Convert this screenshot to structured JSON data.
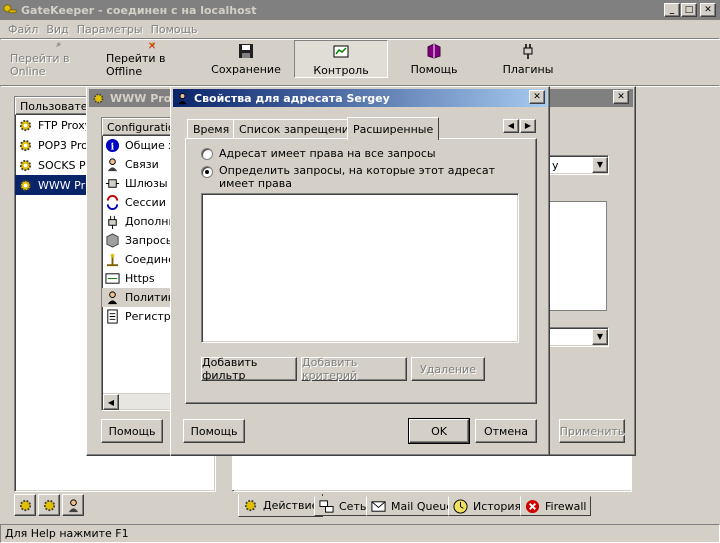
{
  "window": {
    "title": "GateKeeper - соединен с на localhost"
  },
  "menu": [
    "Файл",
    "Вид",
    "Параметры",
    "Помощь"
  ],
  "toolbar": {
    "go_online": "Перейти в Online",
    "go_offline": "Перейти в Offline",
    "save": "Сохранение",
    "control": "Контроль",
    "help": "Помощь",
    "plugins": "Плагины"
  },
  "left_panel": {
    "header": "Пользовате",
    "items": [
      "FTP Proxy",
      "POP3 Pro",
      "SOCKS P",
      "WWW Pr"
    ]
  },
  "proxy_window": {
    "title": "WWW Prox",
    "tree_header": "Configuration",
    "tree_items": [
      "Общие х",
      "Связи",
      "Шлюзы",
      "Сессии",
      "Дополни",
      "Запросы",
      "Соедине",
      "Https",
      "Политик",
      "Регистра"
    ],
    "help_button": "Помощь",
    "combo_value": "y",
    "apply_button": "Применить"
  },
  "dialog": {
    "title": "Свойства для адресата Sergey",
    "tabs": [
      "Время",
      "Список запрещений",
      "Расширенные"
    ],
    "radio_all": "Адресат имеет права на все запросы",
    "radio_define": "Определить запросы, на которые этот адресат имеет права",
    "add_filter": "Добавить фильтр",
    "add_criteria": "Добавить критерий",
    "delete": "Удаление",
    "help": "Помощь",
    "ok": "OK",
    "cancel": "Отмена"
  },
  "bottom_tabs": [
    "Действие",
    "Сеть",
    "Mail Queue",
    "История",
    "Firewall"
  ],
  "status": "Для Help нажмите F1",
  "colors": {
    "active_title": "#0a246a",
    "inactive_title": "#808080",
    "selection": "#0a246a",
    "face": "#d4d0c8"
  }
}
